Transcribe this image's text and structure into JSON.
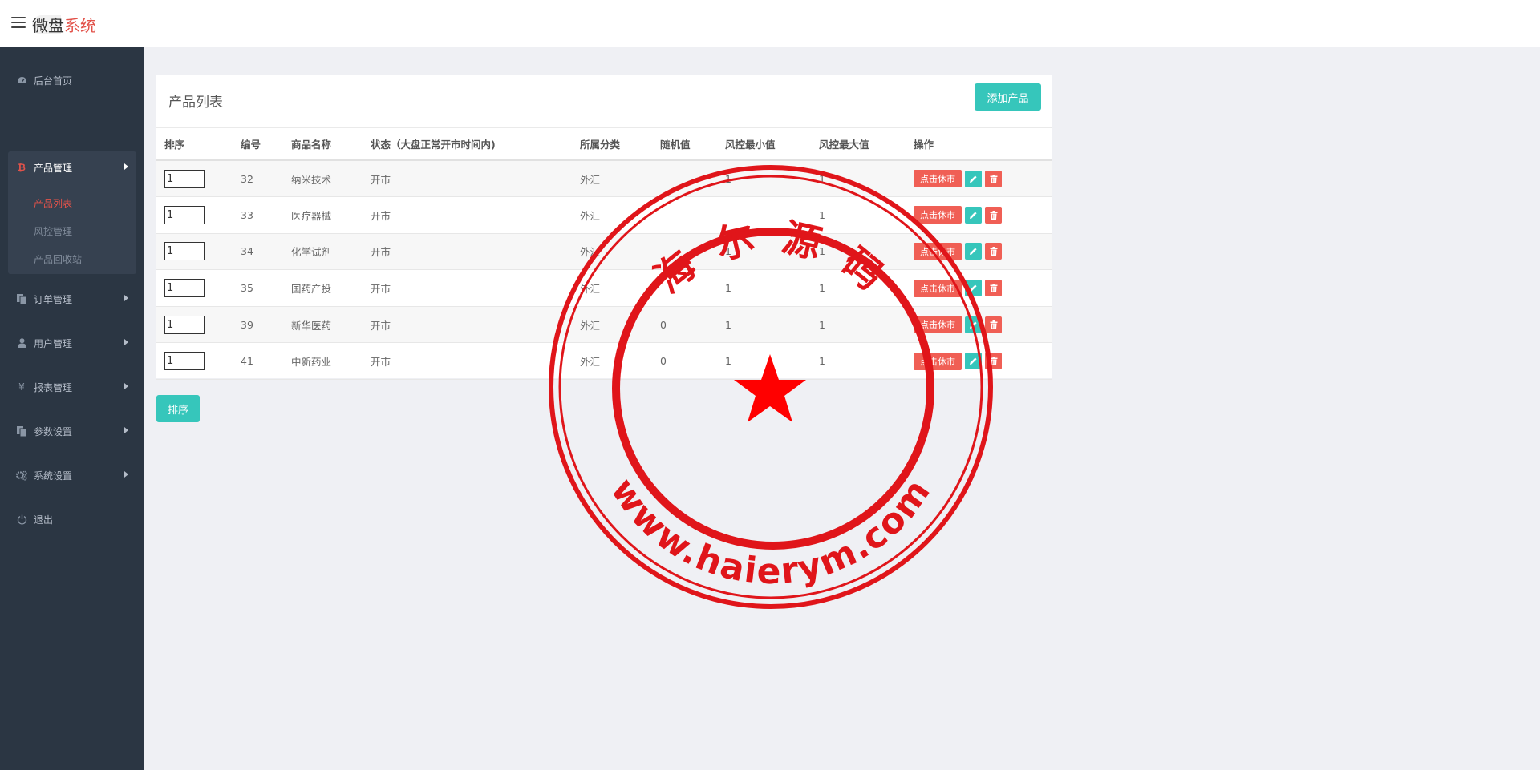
{
  "header": {
    "brand_main": "微盘",
    "brand_accent": "系统",
    "menu_icon": "hamburger-icon"
  },
  "sidebar": {
    "items": [
      {
        "label": "后台首页",
        "icon": "dashboard-icon"
      },
      {
        "label": "产品管理",
        "icon": "bitcoin-icon",
        "children": [
          "产品列表",
          "风控管理",
          "产品回收站"
        ]
      },
      {
        "label": "订单管理",
        "icon": "copy-icon"
      },
      {
        "label": "用户管理",
        "icon": "user-icon"
      },
      {
        "label": "报表管理",
        "icon": "yen-icon"
      },
      {
        "label": "参数设置",
        "icon": "copy-icon"
      },
      {
        "label": "系统设置",
        "icon": "gears-icon"
      },
      {
        "label": "退出",
        "icon": "power-icon"
      }
    ]
  },
  "main": {
    "title": "产品列表",
    "add_button": "添加产品",
    "sort_button": "排序",
    "columns": [
      "排序",
      "编号",
      "商品名称",
      "状态（大盘正常开市时间内)",
      "所属分类",
      "随机值",
      "风控最小值",
      "风控最大值",
      "操作"
    ],
    "rows": [
      {
        "sort": "1",
        "id": "32",
        "name": "纳米技术",
        "status": "开市",
        "category": "外汇",
        "random": "",
        "min": "1",
        "max": "1"
      },
      {
        "sort": "1",
        "id": "33",
        "name": "医疗器械",
        "status": "开市",
        "category": "外汇",
        "random": "",
        "min": "",
        "max": "1"
      },
      {
        "sort": "1",
        "id": "34",
        "name": "化学试剂",
        "status": "开市",
        "category": "外汇",
        "random": "",
        "min": "1",
        "max": "1"
      },
      {
        "sort": "1",
        "id": "35",
        "name": "国药产投",
        "status": "开市",
        "category": "外汇",
        "random": "",
        "min": "1",
        "max": "1"
      },
      {
        "sort": "1",
        "id": "39",
        "name": "新华医药",
        "status": "开市",
        "category": "外汇",
        "random": "0",
        "min": "1",
        "max": "1"
      },
      {
        "sort": "1",
        "id": "41",
        "name": "中新药业",
        "status": "开市",
        "category": "外汇",
        "random": "0",
        "min": "1",
        "max": "1"
      }
    ],
    "row_action": "点击休市"
  },
  "stamp": {
    "top_text": "海 尔 源 码",
    "bottom_text": "www.haierym.com",
    "color": "#e0151a"
  },
  "colors": {
    "accent": "#36c6bb",
    "danger": "#f05f55",
    "sidebar": "#2b3643"
  }
}
